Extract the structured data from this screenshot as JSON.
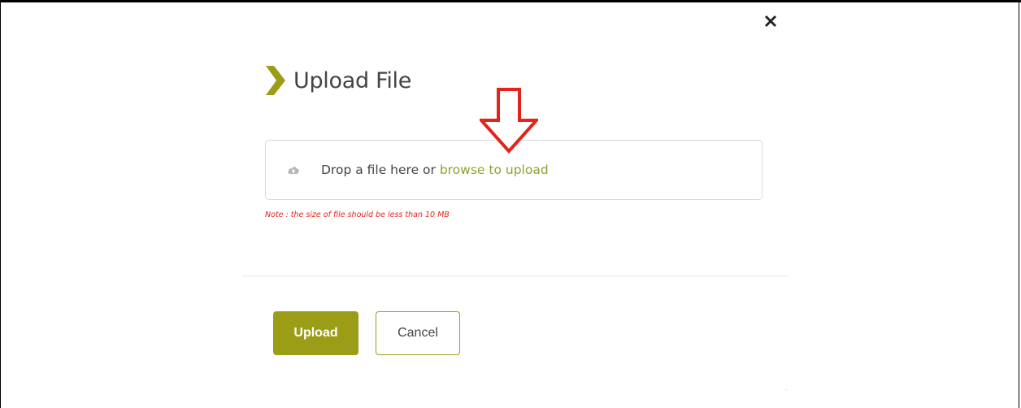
{
  "dialog": {
    "title": "Upload File",
    "close_icon": "close-icon",
    "accent_color": "#9b9d16"
  },
  "drop_zone": {
    "icon": "cloud-upload-icon",
    "prefix_text": "Drop a file here or ",
    "browse_link": "browse to upload"
  },
  "note": "Note : the size of file should be less than 10 MB",
  "buttons": {
    "upload_label": "Upload",
    "cancel_label": "Cancel"
  },
  "annotation": {
    "icon": "red-down-arrow-icon",
    "color": "#e2241b"
  }
}
